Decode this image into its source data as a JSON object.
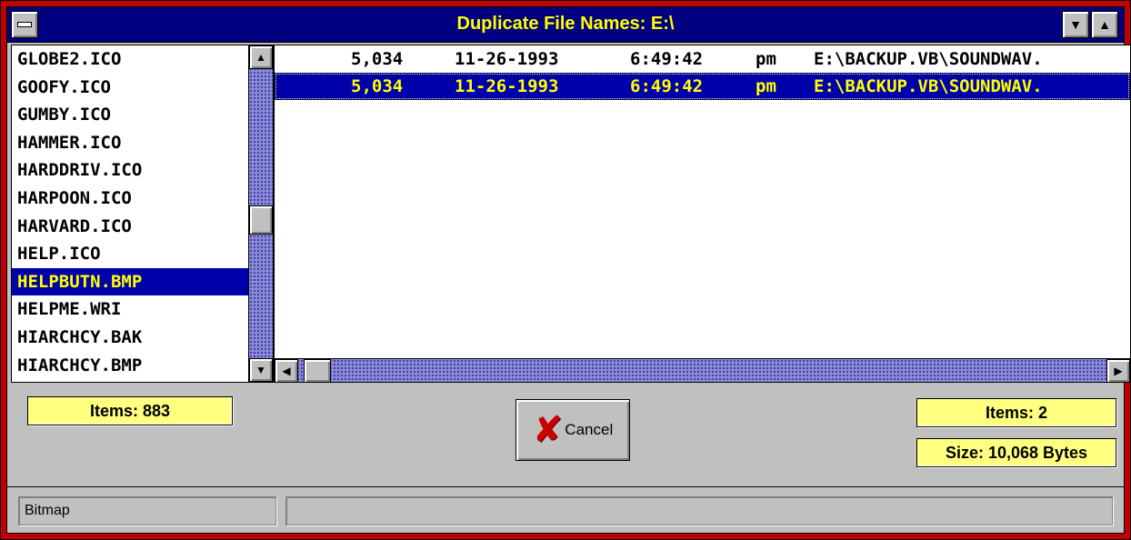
{
  "window": {
    "title": "Duplicate File Names: E:\\",
    "icons": {
      "system_menu": "system-menu-icon",
      "minimize": "minimize-arrow-icon",
      "maximize": "maximize-arrow-icon"
    }
  },
  "left_list": {
    "items": [
      {
        "name": "GLOBE2.ICO"
      },
      {
        "name": "GOOFY.ICO"
      },
      {
        "name": "GUMBY.ICO"
      },
      {
        "name": "HAMMER.ICO"
      },
      {
        "name": "HARDDRIV.ICO"
      },
      {
        "name": "HARPOON.ICO"
      },
      {
        "name": "HARVARD.ICO"
      },
      {
        "name": "HELP.ICO"
      },
      {
        "name": "HELPBUTN.BMP",
        "selected": true
      },
      {
        "name": "HELPME.WRI"
      },
      {
        "name": "HIARCHCY.BAK"
      },
      {
        "name": "HIARCHCY.BMP"
      }
    ],
    "count_label": "Items: 883"
  },
  "right_list": {
    "rows": [
      {
        "size": "5,034",
        "date": "11-26-1993",
        "time": "6:49:42",
        "ampm": "pm",
        "path": "E:\\BACKUP.VB\\SOUNDWAV."
      },
      {
        "size": "5,034",
        "date": "11-26-1993",
        "time": "6:49:42",
        "ampm": "pm",
        "path": "E:\\BACKUP.VB\\SOUNDWAV.",
        "selected": true
      }
    ],
    "count_label": "Items: 2",
    "size_label": "Size: 10,068 Bytes"
  },
  "cancel_button": {
    "label": "Cancel",
    "icon": "red-x-icon"
  },
  "status_bar": {
    "panel1": "Bitmap",
    "panel2": ""
  },
  "colors": {
    "frame": "#c00000",
    "titlebar": "#000080",
    "title_text": "#ffff00",
    "selection": "#0000aa",
    "selection_text": "#ffff00",
    "info_box": "#ffff80",
    "face": "#c0c0c0"
  }
}
